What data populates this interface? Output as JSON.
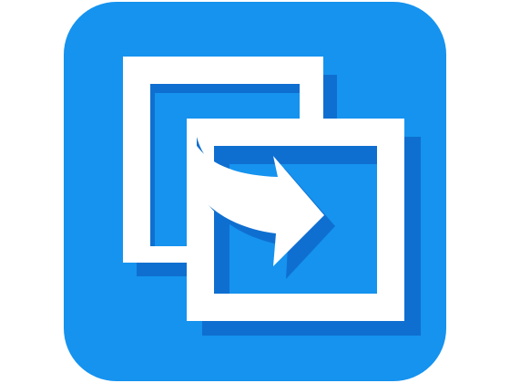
{
  "icon": {
    "name": "transfer-windows-icon",
    "colors": {
      "tile": "#1593ef",
      "shadow": "#0f6fd0",
      "frame": "#ffffff",
      "page_background": "#ffffff"
    }
  }
}
